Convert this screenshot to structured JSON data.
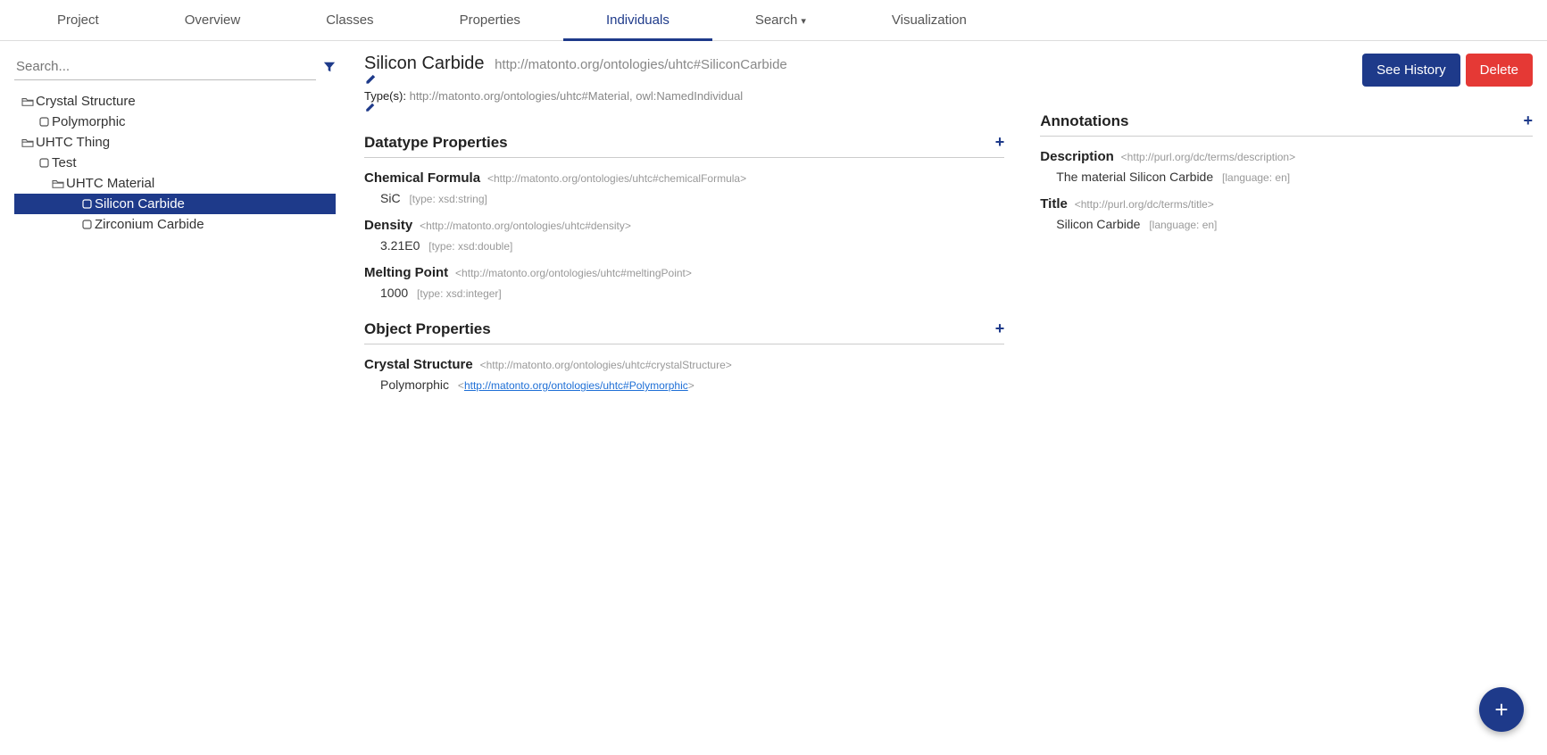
{
  "tabs": {
    "project": "Project",
    "overview": "Overview",
    "classes": "Classes",
    "properties": "Properties",
    "individuals": "Individuals",
    "search": "Search",
    "visualization": "Visualization"
  },
  "search": {
    "placeholder": "Search..."
  },
  "tree": {
    "crystal_structure": "Crystal Structure",
    "polymorphic": "Polymorphic",
    "uhtc_thing": "UHTC Thing",
    "test": "Test",
    "uhtc_material": "UHTC Material",
    "silicon_carbide": "Silicon Carbide",
    "zirconium_carbide": "Zirconium Carbide"
  },
  "header": {
    "title": "Silicon Carbide",
    "uri": "http://matonto.org/ontologies/uhtc#SiliconCarbide",
    "types_label": "Type(s):",
    "types_value": "http://matonto.org/ontologies/uhtc#Material, owl:NamedIndividual",
    "see_history": "See History",
    "delete": "Delete"
  },
  "sections": {
    "datatype": "Datatype Properties",
    "object": "Object Properties",
    "annotations": "Annotations"
  },
  "datatype": {
    "chem": {
      "label": "Chemical Formula",
      "iri": "<http://matonto.org/ontologies/uhtc#chemicalFormula>",
      "value": "SiC",
      "meta": "[type: xsd:string]"
    },
    "density": {
      "label": "Density",
      "iri": "<http://matonto.org/ontologies/uhtc#density>",
      "value": "3.21E0",
      "meta": "[type: xsd:double]"
    },
    "melting": {
      "label": "Melting Point",
      "iri": "<http://matonto.org/ontologies/uhtc#meltingPoint>",
      "value": "1000",
      "meta": "[type: xsd:integer]"
    }
  },
  "object": {
    "crystal": {
      "label": "Crystal Structure",
      "iri": "<http://matonto.org/ontologies/uhtc#crystalStructure>",
      "value": "Polymorphic",
      "link_open": "<",
      "link": "http://matonto.org/ontologies/uhtc#Polymorphic",
      "link_close": ">"
    }
  },
  "annotations": {
    "desc": {
      "label": "Description",
      "iri": "<http://purl.org/dc/terms/description>",
      "value": "The material Silicon Carbide",
      "meta": "[language: en]"
    },
    "title": {
      "label": "Title",
      "iri": "<http://purl.org/dc/terms/title>",
      "value": "Silicon Carbide",
      "meta": "[language: en]"
    }
  }
}
